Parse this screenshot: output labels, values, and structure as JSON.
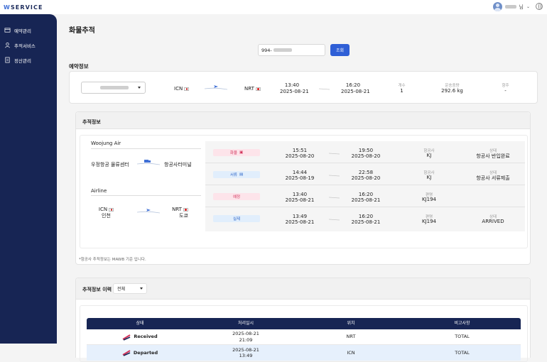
{
  "header": {
    "logo_prefix": "W",
    "logo_rest": "SERVICE",
    "user_suffix": "님"
  },
  "sidebar": {
    "items": [
      {
        "label": "예약관리",
        "icon": "folder-icon"
      },
      {
        "label": "추적서비스",
        "icon": "person-icon"
      },
      {
        "label": "정산관리",
        "icon": "document-icon"
      }
    ]
  },
  "page": {
    "title": "화물추적"
  },
  "search": {
    "prefix": "994-",
    "button": "조회"
  },
  "booking": {
    "section": "예약정보",
    "origin": "ICN",
    "destination": "NRT",
    "dep_time": "13:40",
    "dep_date": "2025-08-21",
    "arr_time": "16:20",
    "arr_date": "2025-08-21",
    "count_label": "개수",
    "count": "1",
    "weight_label": "운송중량",
    "weight": "292.6 kg",
    "flight_label": "항주",
    "flight": "-"
  },
  "tracking": {
    "section": "추적정보",
    "woojung": {
      "name": "Woojung Air",
      "from": "우정항공 물류센터",
      "to": "항공사터미널"
    },
    "airline": {
      "name": "Airline",
      "from_code": "ICN",
      "from_city": "인천",
      "to_code": "NRT",
      "to_city": "도쿄"
    },
    "rows": [
      {
        "tag": "화물",
        "tag_color": "pink",
        "t1": "15:51",
        "d1": "2025-08-20",
        "t2": "19:50",
        "d2": "2025-08-20",
        "l1": "항공사",
        "v1": "KJ",
        "l2": "상태",
        "v2": "항공사 반입완료"
      },
      {
        "tag": "서류",
        "tag_color": "blue",
        "t1": "14:44",
        "d1": "2025-08-19",
        "t2": "22:58",
        "d2": "2025-08-20",
        "l1": "항공사",
        "v1": "KJ",
        "l2": "상태",
        "v2": "항공사 서류제출"
      },
      {
        "tag": "예정",
        "tag_color": "pink",
        "t1": "13:40",
        "d1": "2025-08-21",
        "t2": "16:20",
        "d2": "2025-08-21",
        "l1": "편명",
        "v1": "KJ194",
        "l2": "",
        "v2": ""
      },
      {
        "tag": "실제",
        "tag_color": "blue",
        "t1": "13:49",
        "d1": "2025-08-21",
        "t2": "16:20",
        "d2": "2025-08-21",
        "l1": "편명",
        "v1": "KJ194",
        "l2": "상태",
        "v2": "ARRIVED"
      }
    ],
    "note": "*항공사 추적정보는 MAWB 기준 입니다."
  },
  "history": {
    "section": "추적정보 이력",
    "filter": "전체",
    "columns": [
      "상태",
      "처리일시",
      "위치",
      "비고사항"
    ],
    "rows": [
      {
        "status": "Received",
        "date": "2025-08-21",
        "time": "21:09",
        "loc": "NRT",
        "remark": "TOTAL"
      },
      {
        "status": "Departed",
        "date": "2025-08-21",
        "time": "13:49",
        "loc": "ICN",
        "remark": "TOTAL"
      }
    ]
  }
}
